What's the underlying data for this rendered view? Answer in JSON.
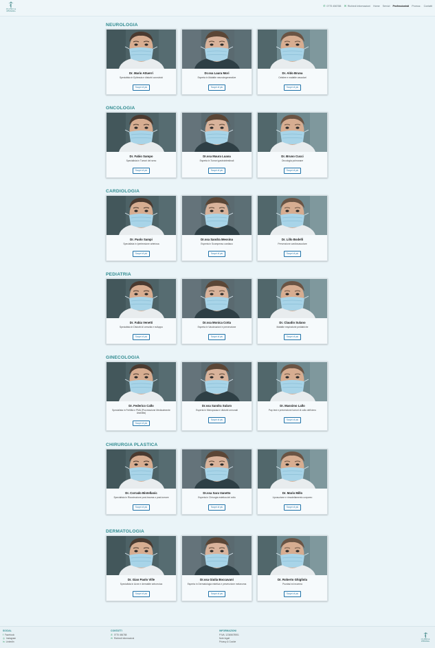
{
  "header": {
    "logo_line1": "CLINICA",
    "logo_line2": "PRISMA",
    "nav": [
      {
        "label": "0775 456788",
        "icon": "phone-icon",
        "active": false
      },
      {
        "label": "Richiedi informazioni",
        "icon": "mail-icon",
        "active": false
      },
      {
        "label": "Home",
        "active": false
      },
      {
        "label": "Servizi",
        "active": false
      },
      {
        "label": "Professionisti",
        "active": true
      },
      {
        "label": "Promoz.",
        "active": false
      },
      {
        "label": "Contatti",
        "active": false
      }
    ]
  },
  "button_label": "Scopri di più",
  "sections": [
    {
      "title": "NEUROLOGIA",
      "doctors": [
        {
          "name": "Dr. Mario Attuerri",
          "spec": "Specialista in Epilessia e disturbi convulsivi",
          "gender": "m"
        },
        {
          "name": "Dr.ssa Laura Mori",
          "spec": "Esperta in Malattie neurodegenerative",
          "gender": "f"
        },
        {
          "name": "Dr. Aldo Bruna",
          "spec": "Cefalee e malattie vascolari",
          "gender": "m2"
        }
      ]
    },
    {
      "title": "ONCOLOGIA",
      "doctors": [
        {
          "name": "Dr. Fabio Sampo",
          "spec": "Specialista in Tumori del seno",
          "gender": "m"
        },
        {
          "name": "Dr.ssa Maura Luana",
          "spec": "Esperta in Tumori gastrointestinali",
          "gender": "f"
        },
        {
          "name": "Dr. Bruno Cucci",
          "spec": "Oncologia polmonare",
          "gender": "m2"
        }
      ]
    },
    {
      "title": "CARDIOLOGIA",
      "doctors": [
        {
          "name": "Dr. Paolo Sampi",
          "spec": "Specialista in Ipertensione arteriosa",
          "gender": "m"
        },
        {
          "name": "Dr.ssa Sandra Messina",
          "spec": "Esperta in Scompenso cardiaco",
          "gender": "f"
        },
        {
          "name": "Dr. Lillo Bodelli",
          "spec": "Prevenzione cardiovascolare",
          "gender": "m2"
        }
      ]
    },
    {
      "title": "PEDIATRIA",
      "doctors": [
        {
          "name": "Dr. Fabia Venetti",
          "spec": "Specialista in Disturbi di crescita e sviluppo",
          "gender": "m"
        },
        {
          "name": "Dr.ssa Monica Cotta",
          "spec": "Esperta in Vaccinazioni e prevenzione",
          "gender": "f"
        },
        {
          "name": "Dr. Claudio Sulano",
          "spec": "Malattie respiratorie pediatriche",
          "gender": "m2"
        }
      ]
    },
    {
      "title": "GINECOLOGIA",
      "doctors": [
        {
          "name": "Dr. Federico Callo",
          "spec": "Specialista in Fertilità e PMA (Procreazione Medicalmente Assistita)",
          "gender": "m"
        },
        {
          "name": "Dr.ssa Sandra Sularo",
          "spec": "Esperta in Menopausa e disturbi ormonali",
          "gender": "f"
        },
        {
          "name": "Dr. Massimo Lallo",
          "spec": "Pap test e prevenzione tumori di collo dell'utero",
          "gender": "m2"
        }
      ]
    },
    {
      "title": "CHIRURGIA PLASTICA",
      "doctors": [
        {
          "name": "Dr. Corrado Bintellanic",
          "spec": "Specialista in Ricostruzione post-trauma o post-tumore",
          "gender": "m"
        },
        {
          "name": "Dr.ssa Sara Vanetto",
          "spec": "Esperta in Chirurgia estetica del volto",
          "gender": "f"
        },
        {
          "name": "Dr. Mario Millo",
          "spec": "Liposuzione e rimodellamento corporeo",
          "gender": "m2"
        }
      ]
    },
    {
      "title": "DERMATOLOGIA",
      "doctors": [
        {
          "name": "Dr. Gian Paolo Ville",
          "spec": "Specialista in Acne e dermatite seborroica",
          "gender": "m"
        },
        {
          "name": "Dr.ssa Giulia Boccavani",
          "spec": "Esperta in Dermatologia estetica e prevenzione melanoma",
          "gender": "f"
        },
        {
          "name": "Dr. Roberto Ghigliola",
          "spec": "Psoriasi ed eczema",
          "gender": "m2"
        }
      ]
    }
  ],
  "footer": {
    "social_title": "SOCIAL",
    "social": [
      {
        "label": "Facebook",
        "icon": "facebook-icon"
      },
      {
        "label": "Instagram",
        "icon": "instagram-icon"
      },
      {
        "label": "LinkedIn",
        "icon": "linkedin-icon"
      }
    ],
    "contact_title": "CONTATTI",
    "contacts": [
      {
        "label": "0775 456788",
        "icon": "phone-icon"
      },
      {
        "label": "Richiedi informazioni",
        "icon": "mail-icon"
      }
    ],
    "info_title": "INFORMAZIONI",
    "info": [
      "P.IVA: 12345678901",
      "Note legali",
      "Privacy & Cookie"
    ],
    "logo_line1": "CLINICA",
    "logo_line2": "PRISMA"
  }
}
